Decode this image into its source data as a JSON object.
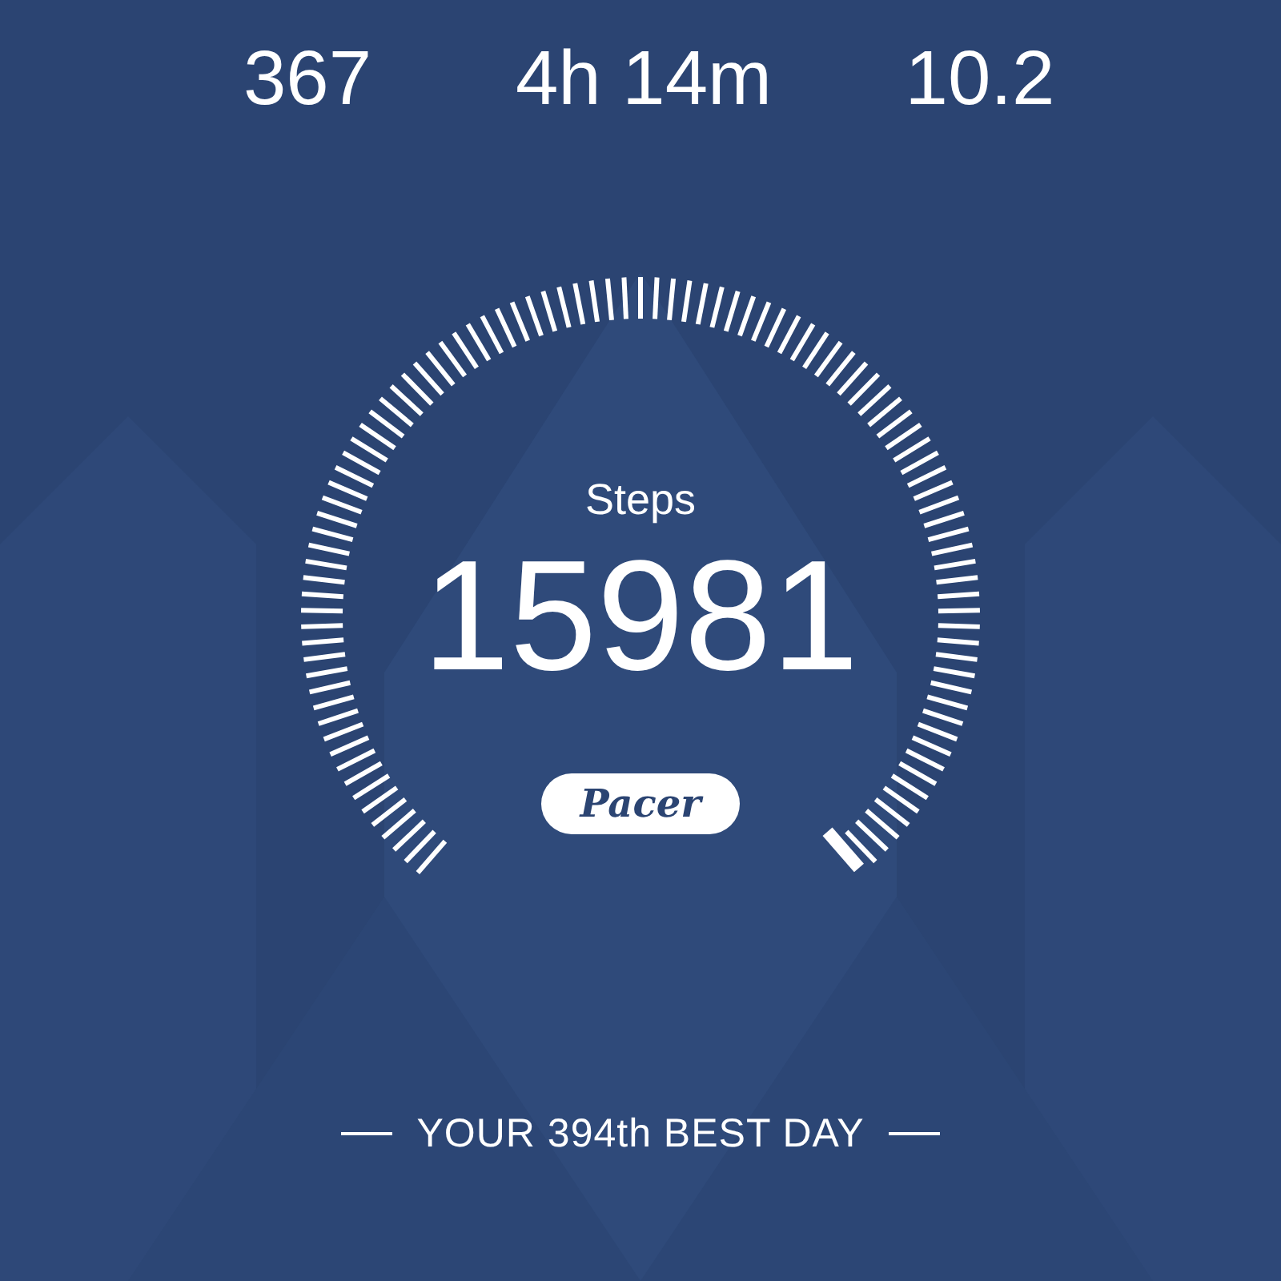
{
  "stats": [
    {
      "value": "367"
    },
    {
      "value": "4h 14m"
    },
    {
      "value": "10.2"
    }
  ],
  "gauge": {
    "label": "Steps",
    "value": "15981",
    "logo": "Pacer"
  },
  "footer": {
    "text": "YOUR 394th BEST DAY"
  }
}
